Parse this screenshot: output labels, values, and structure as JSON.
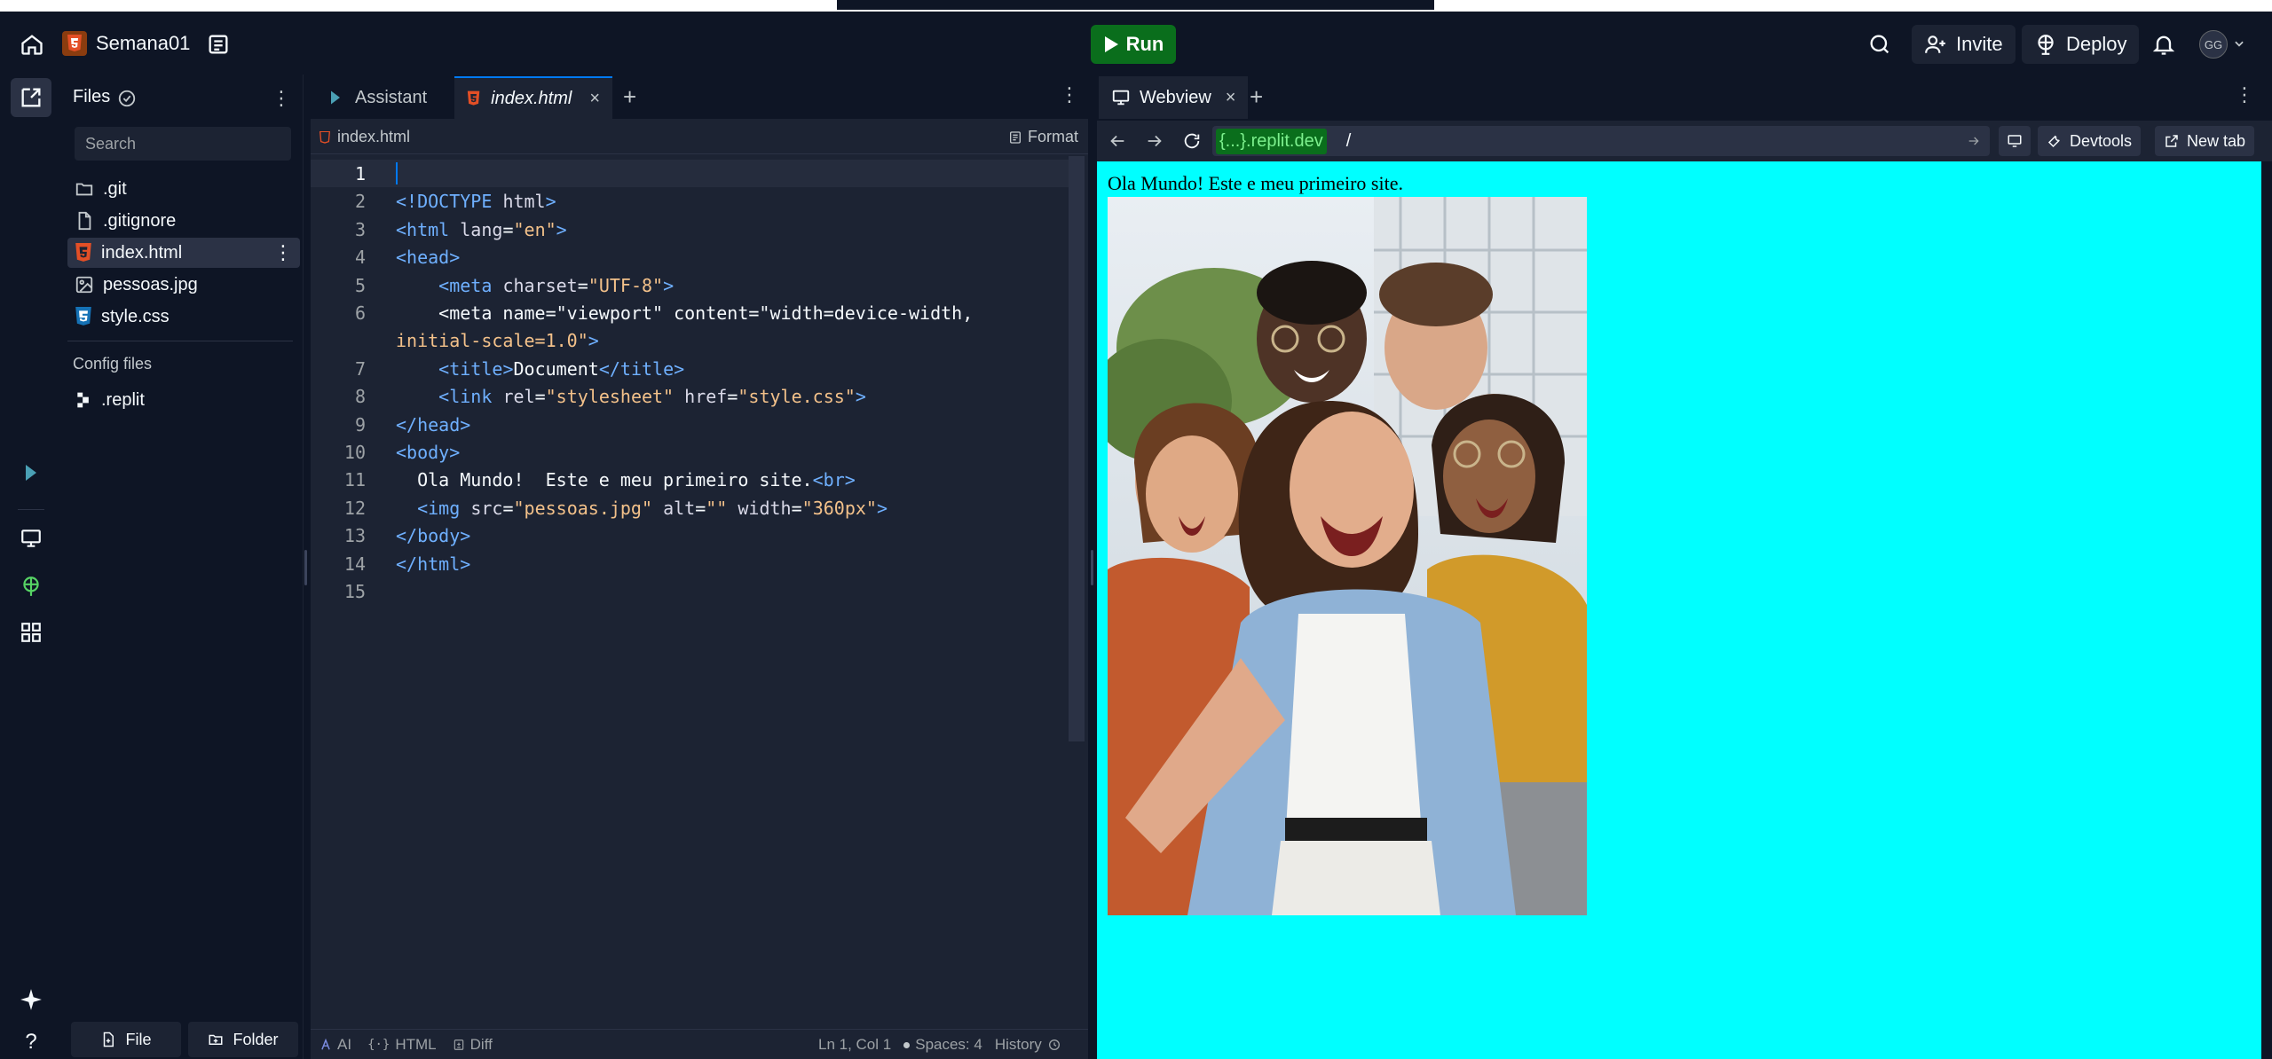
{
  "header": {
    "project_name": "Semana01",
    "run_label": "Run",
    "invite_label": "Invite",
    "deploy_label": "Deploy",
    "avatar_initials": "GG"
  },
  "files_panel": {
    "title": "Files",
    "search_placeholder": "Search",
    "files": [
      {
        "name": ".git",
        "icon": "folder-icon"
      },
      {
        "name": ".gitignore",
        "icon": "file-icon"
      },
      {
        "name": "index.html",
        "icon": "html5-icon"
      },
      {
        "name": "pessoas.jpg",
        "icon": "image-icon"
      },
      {
        "name": "style.css",
        "icon": "css3-icon"
      }
    ],
    "config_label": "Config files",
    "config_files": [
      {
        "name": ".replit",
        "icon": "replit-icon"
      }
    ],
    "new_file_label": "File",
    "new_folder_label": "Folder"
  },
  "editor": {
    "tabs": [
      {
        "label": "Assistant"
      },
      {
        "label": "index.html"
      }
    ],
    "breadcrumb": "index.html",
    "format_label": "Format",
    "code_lines": [
      "",
      "<!DOCTYPE html>",
      "<html lang=\"en\">",
      "<head>",
      "    <meta charset=\"UTF-8\">",
      "    <meta name=\"viewport\" content=\"width=device-width,",
      "initial-scale=1.0\">",
      "    <title>Document</title>",
      "    <link rel=\"stylesheet\" href=\"style.css\">",
      "</head>",
      "<body>",
      "  Ola Mundo!  Este e meu primeiro site.<br>",
      "  <img src=\"pessoas.jpg\" alt=\"\" width=\"360px\">",
      "</body>",
      "</html>",
      ""
    ],
    "status": {
      "ai": "AI",
      "lang": "HTML",
      "diff": "Diff",
      "position": "Ln 1, Col 1",
      "spaces": "Spaces: 4",
      "history": "History"
    }
  },
  "webview": {
    "tab_label": "Webview",
    "url_host": "{...}.replit.dev",
    "url_path": "/",
    "devtools_label": "Devtools",
    "new_tab_label": "New tab",
    "page_text": "Ola Mundo! Este e meu primeiro site.",
    "page_bg": "#00ffff"
  },
  "colors": {
    "bg": "#0e1525",
    "panel": "#1c2333",
    "accent": "#0079f2",
    "run": "#0a6e1c"
  }
}
